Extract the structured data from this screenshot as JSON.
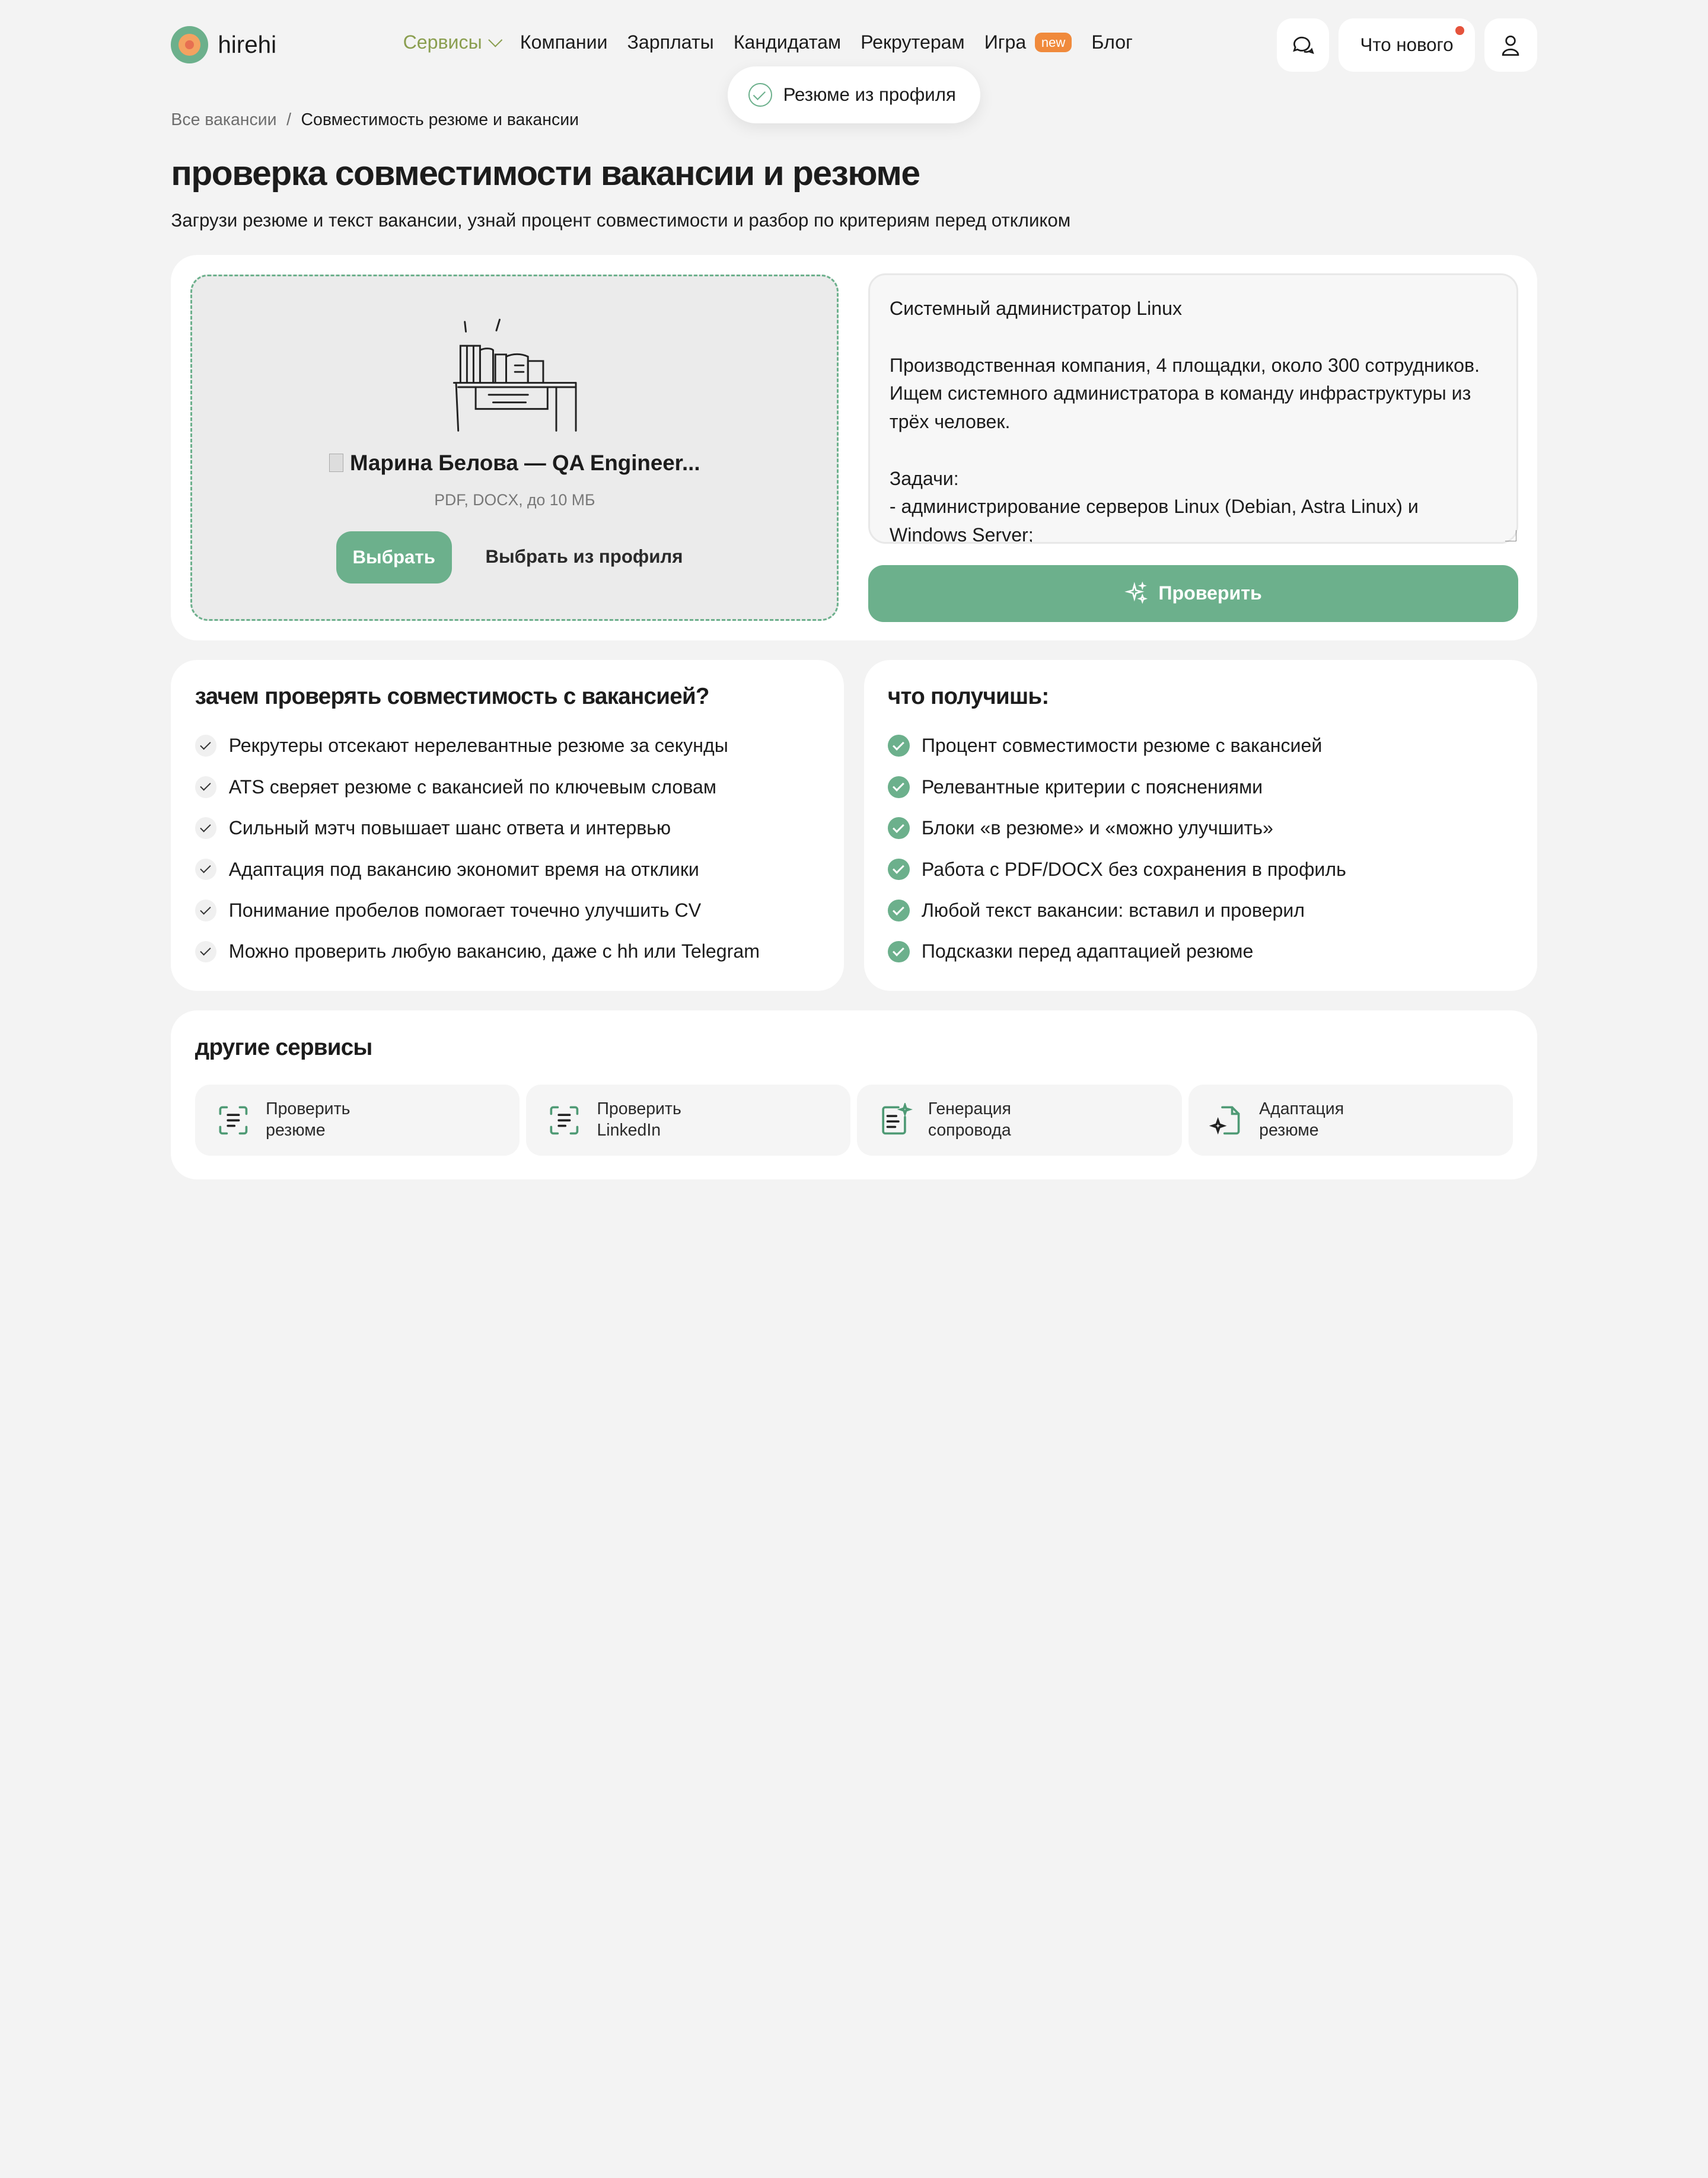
{
  "header": {
    "logo_text": "hirehi",
    "nav": [
      {
        "label": "Сервисы"
      },
      {
        "label": "Компании"
      },
      {
        "label": "Зарплаты"
      },
      {
        "label": "Кандидатам"
      },
      {
        "label": "Рекрутерам"
      },
      {
        "label": "Игра"
      },
      {
        "label": "Блог"
      }
    ],
    "new_badge": "new",
    "whats_new": "Что нового"
  },
  "toast": {
    "text": "Резюме из профиля"
  },
  "breadcrumb": {
    "root": "Все вакансии",
    "separator": "/",
    "current": "Совместимость резюме и вакансии"
  },
  "page": {
    "title": "проверка совместимости вакансии и резюме",
    "subtitle": "Загрузи резюме и текст вакансии, узнай процент совместимости и разбор по критериям перед откликом"
  },
  "upload": {
    "file_name": "Марина Белова — QA Engineer...",
    "hint": "PDF, DOCX, до 10 МБ",
    "choose_button": "Выбрать",
    "profile_button": "Выбрать из профиля"
  },
  "vacancy": {
    "text": "Системный администратор Linux\n\nПроизводственная компания, 4 площадки, около 300 сотрудников. Ищем системного администратора в команду инфраструктуры из трёх человек.\n\nЗадачи:\n- администрирование серверов Linux (Debian, Astra Linux) и Windows Server;"
  },
  "check_button": "Проверить",
  "why": {
    "title": "зачем проверять совместимость с вакансией?",
    "items": [
      "Рекрутеры отсекают нерелевантные резюме за секунды",
      "ATS сверяет резюме с вакансией по ключевым словам",
      "Сильный мэтч повышает шанс ответа и интервью",
      "Адаптация под вакансию экономит время на отклики",
      "Понимание пробелов помогает точечно улучшить CV",
      "Можно проверить любую вакансию, даже с hh или Telegram"
    ]
  },
  "get": {
    "title": "что получишь:",
    "items": [
      "Процент совместимости резюме с вакансией",
      "Релевантные критерии с пояснениями",
      "Блоки «в резюме» и «можно улучшить»",
      "Работа с PDF/DOCX без сохранения в профиль",
      "Любой текст вакансии: вставил и проверил",
      "Подсказки перед адаптацией резюме"
    ]
  },
  "other": {
    "title": "другие сервисы",
    "services": [
      {
        "line1": "Проверить",
        "line2": "резюме",
        "icon": "scan-doc-icon"
      },
      {
        "line1": "Проверить",
        "line2": "LinkedIn",
        "icon": "scan-doc-icon"
      },
      {
        "line1": "Генерация",
        "line2": "сопровода",
        "icon": "doc-sparkle-icon"
      },
      {
        "line1": "Адаптация",
        "line2": "резюме",
        "icon": "file-sparkle-icon"
      }
    ]
  },
  "colors": {
    "accent": "#6cb08c",
    "nav_active": "#8a9e4f",
    "badge": "#f08a3c",
    "background": "#f3f3f3"
  }
}
